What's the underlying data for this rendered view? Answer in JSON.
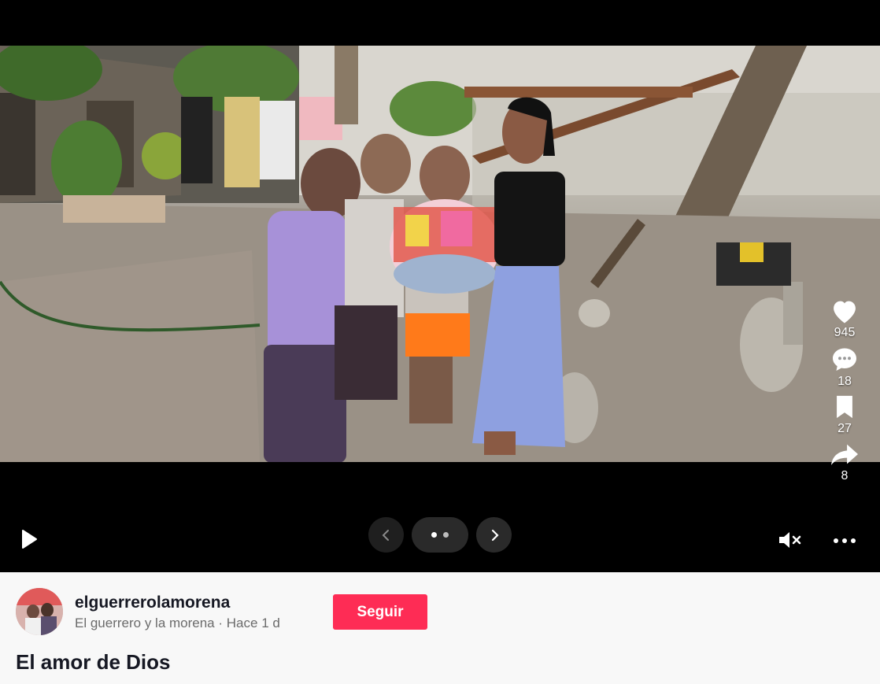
{
  "post": {
    "image_alt": "Fotografía de una joven entregando una canasta de regalos a tres niños en un patio",
    "photo_colors": {
      "ground": "#9a9186",
      "wall": "#d9d6cf",
      "tree": "#6e6050"
    }
  },
  "actions": {
    "likes": "945",
    "comments": "18",
    "saves": "27",
    "shares": "8",
    "like_icon": "heart-icon",
    "comment_icon": "comment-icon",
    "save_icon": "bookmark-icon",
    "share_icon": "share-icon"
  },
  "controls": {
    "play_icon": "play-icon",
    "prev_icon": "chevron-left-icon",
    "next_icon": "chevron-right-icon",
    "mute_icon": "muted-speaker-icon",
    "more_icon": "more-icon",
    "slide_count": 2,
    "active_slide": 1
  },
  "author": {
    "username": "elguerrerolamorena",
    "display_name": "El guerrero y la morena",
    "separator": "·",
    "posted": "Hace 1 d",
    "follow_label": "Seguir"
  },
  "caption": "El amor de Dios",
  "colors": {
    "accent": "#fe2c55",
    "background": "#f8f8f8",
    "text": "#161823"
  }
}
